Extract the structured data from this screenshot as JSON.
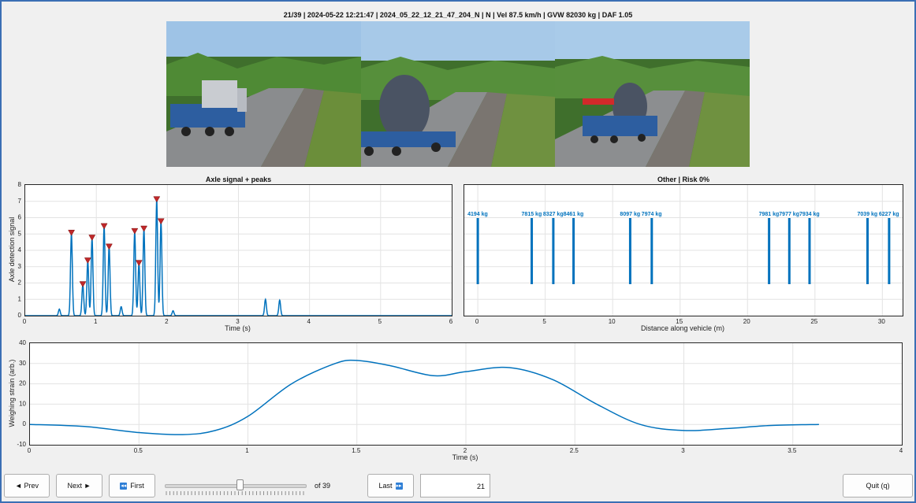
{
  "header": {
    "title": "21/39 | 2024-05-22 12:21:47 | 2024_05_22_12_21_47_204_N | N | Vel 87.5 km/h | GVW 82030 kg | DAF 1.05"
  },
  "colors": {
    "accent": "#0072bd",
    "marker": "#c0282a",
    "window_border": "#3b6fb4"
  },
  "cameras": [
    "camera-1",
    "camera-2",
    "camera-3"
  ],
  "axle_chart": {
    "title": "Axle signal + peaks",
    "xlabel": "Time (s)",
    "ylabel": "Axle detection signal",
    "xticks": [
      "0",
      "1",
      "2",
      "3",
      "4",
      "5",
      "6"
    ],
    "yticks": [
      "0",
      "1",
      "2",
      "3",
      "4",
      "5",
      "6",
      "7",
      "8"
    ]
  },
  "other_chart": {
    "title": "Other | Risk 0%",
    "xlabel": "Distance along vehicle (m)",
    "xticks": [
      "0",
      "5",
      "10",
      "15",
      "20",
      "25",
      "30"
    ]
  },
  "strain_chart": {
    "xlabel": "Time (s)",
    "ylabel": "Weighing strain (arb.)",
    "xticks": [
      "0",
      "0.5",
      "1",
      "1.5",
      "2",
      "2.5",
      "3",
      "3.5",
      "4"
    ],
    "yticks": [
      "-10",
      "0",
      "10",
      "20",
      "30",
      "40"
    ]
  },
  "controls": {
    "prev_label": "◄ Prev",
    "next_label": "Next ►",
    "first_label": "First",
    "of_label": "of 39",
    "last_label": "Last",
    "index_value": "21",
    "quit_label": "Quit (q)",
    "slider_value": 21,
    "slider_max": 39
  },
  "chart_data": [
    {
      "type": "line",
      "title": "Axle signal + peaks",
      "xlabel": "Time (s)",
      "ylabel": "Axle detection signal",
      "xlim": [
        0,
        6
      ],
      "ylim": [
        0,
        8
      ],
      "grid": true,
      "series": [
        {
          "values": [
            [
              0.65,
              5.05
            ],
            [
              0.81,
              1.9
            ],
            [
              0.88,
              3.35
            ],
            [
              0.94,
              4.75
            ],
            [
              1.11,
              5.45
            ],
            [
              1.18,
              4.2
            ],
            [
              1.54,
              5.15
            ],
            [
              1.6,
              3.2
            ],
            [
              1.67,
              5.3
            ],
            [
              1.85,
              7.1
            ],
            [
              1.91,
              5.75
            ],
            [
              0.48,
              0.4
            ],
            [
              1.35,
              0.55
            ],
            [
              2.08,
              0.3
            ],
            [
              3.38,
              1.0
            ],
            [
              3.58,
              0.95
            ]
          ]
        }
      ],
      "peaks": [
        [
          0.65,
          5.05
        ],
        [
          0.81,
          1.9
        ],
        [
          0.88,
          3.35
        ],
        [
          0.94,
          4.75
        ],
        [
          1.11,
          5.45
        ],
        [
          1.18,
          4.2
        ],
        [
          1.54,
          5.15
        ],
        [
          1.6,
          3.2
        ],
        [
          1.67,
          5.3
        ],
        [
          1.85,
          7.1
        ],
        [
          1.91,
          5.75
        ]
      ]
    },
    {
      "type": "bar",
      "title": "Other | Risk 0%",
      "xlabel": "Distance along vehicle (m)",
      "xlim": [
        -1,
        31.5
      ],
      "grid": true,
      "x": [
        0,
        4.0,
        5.6,
        7.1,
        11.3,
        12.9,
        21.6,
        23.1,
        24.6,
        28.9,
        30.5
      ],
      "labels": [
        "4194 kg",
        "7815 kg",
        "8327 kg",
        "8461 kg",
        "8097 kg",
        "7974 kg",
        "7981 kg",
        "7977 kg",
        "7934 kg",
        "7039 kg",
        "6227 kg"
      ]
    },
    {
      "type": "line",
      "xlabel": "Time (s)",
      "ylabel": "Weighing strain (arb.)",
      "xlim": [
        0,
        4
      ],
      "ylim": [
        -10,
        40
      ],
      "grid": true,
      "series": [
        {
          "x": [
            0,
            0.25,
            0.5,
            0.7,
            0.85,
            1.0,
            1.2,
            1.4,
            1.5,
            1.65,
            1.85,
            2.0,
            2.2,
            2.4,
            2.6,
            2.8,
            3.0,
            3.2,
            3.4,
            3.62
          ],
          "y": [
            0,
            -1,
            -4,
            -5,
            -3,
            4,
            20,
            30,
            31.5,
            29,
            24,
            26,
            28,
            22,
            10,
            0,
            -3,
            -2,
            -0.5,
            0
          ]
        }
      ]
    }
  ]
}
